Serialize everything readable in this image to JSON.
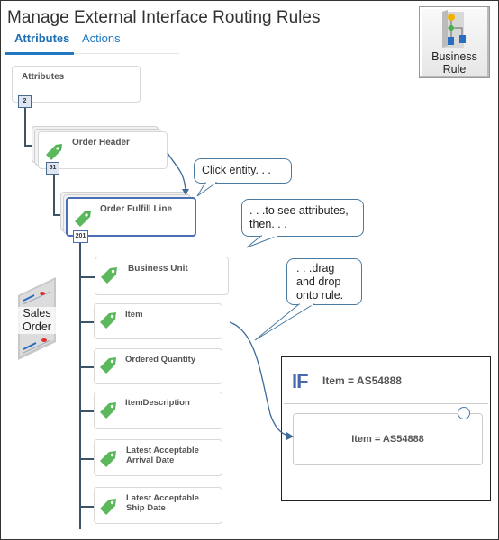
{
  "page": {
    "title": "Manage External Interface Routing Rules"
  },
  "tabs": [
    {
      "label": "Attributes",
      "active": true
    },
    {
      "label": "Actions",
      "active": false
    }
  ],
  "business_rule_button": {
    "label_line1": "Business",
    "label_line2": "Rule",
    "icon": "flowchart-icon"
  },
  "tree": {
    "root": {
      "label": "Attributes",
      "count": "2"
    },
    "order_header": {
      "label": "Order Header",
      "count": "51",
      "icon": "tag-icon"
    },
    "order_fulfill_line": {
      "label": "Order Fulfill Line",
      "count": "201",
      "icon": "tag-icon",
      "selected": true
    },
    "attributes": [
      {
        "line1": "Business Unit",
        "line2": ""
      },
      {
        "line1": "Item",
        "line2": ""
      },
      {
        "line1": "Ordered Quantity",
        "line2": ""
      },
      {
        "line1": "ItemDescription",
        "line2": ""
      },
      {
        "line1": "Latest Acceptable",
        "line2": "Arrival Date"
      },
      {
        "line1": "Latest Acceptable",
        "line2": "Ship Date"
      }
    ]
  },
  "sales_order_icon": {
    "line1": "Sales",
    "line2": "Order"
  },
  "callouts": {
    "click_entity": "Click entity. . .",
    "see_attributes_line1": ". . .to see attributes,",
    "see_attributes_line2": "then. . .",
    "drag_line1": ". . .drag",
    "drag_line2": "and drop",
    "drag_line3": "onto rule."
  },
  "rule": {
    "keyword": "IF",
    "title": "Item = AS54888",
    "condition": "Item = AS54888"
  },
  "colors": {
    "accent": "#1f78c1",
    "tag_green": "#5cb85c",
    "selected_border": "#4a6fb5",
    "if_blue": "#4a68b0"
  }
}
